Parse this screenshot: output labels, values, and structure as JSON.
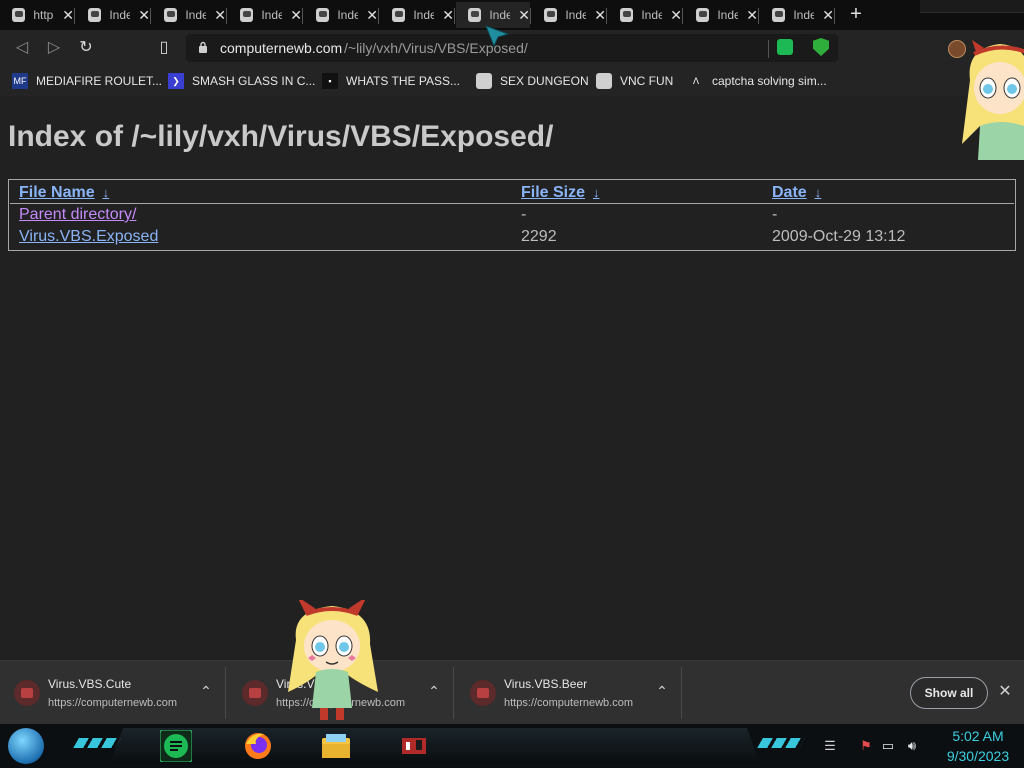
{
  "browser": {
    "tabs": [
      {
        "title": "http",
        "active": false
      },
      {
        "title": "Inde",
        "active": false
      },
      {
        "title": "Inde",
        "active": false
      },
      {
        "title": "Inde",
        "active": false
      },
      {
        "title": "Inde",
        "active": false
      },
      {
        "title": "Inde",
        "active": false
      },
      {
        "title": "Inde",
        "active": true
      },
      {
        "title": "Inde",
        "active": false
      },
      {
        "title": "Inde",
        "active": false
      },
      {
        "title": "Inde",
        "active": false
      },
      {
        "title": "Inde",
        "active": false
      }
    ],
    "close_glyph": "✕",
    "new_tab_glyph": "+",
    "url_host": "computernewb.com",
    "url_path": "/~lily/vxh/Virus/VBS/Exposed/",
    "bookmarks": [
      {
        "icon": "mediafire-icon",
        "badge": "MF",
        "label": "MEDIAFIRE ROULET...",
        "color": "#1f3a8a"
      },
      {
        "icon": "chevron-logo-icon",
        "badge": "❯",
        "label": "SMASH GLASS IN C...",
        "color": "#3b3fd1"
      },
      {
        "icon": "dark-square-icon",
        "badge": "▪",
        "label": "WHATS THE PASS...",
        "color": "#111111"
      },
      {
        "icon": "computer-icon",
        "badge": "",
        "label": "SEX DUNGEON",
        "color": "#cfcfcf"
      },
      {
        "icon": "computer-icon",
        "badge": "",
        "label": "VNC FUN",
        "color": "#cfcfcf"
      },
      {
        "icon": "lambda-icon",
        "badge": "Λ",
        "label": "captcha solving sim...",
        "color": "#242424"
      }
    ]
  },
  "page": {
    "title": "Index of /~lily/vxh/Virus/VBS/Exposed/",
    "columns": {
      "name": "File Name",
      "size": "File Size",
      "date": "Date",
      "sort_glyph": "↓"
    },
    "rows": [
      {
        "name": "Parent directory/",
        "size": "-",
        "date": "-"
      },
      {
        "name": "Virus.VBS.Exposed",
        "size": "2292",
        "date": "2009-Oct-29 13:12"
      }
    ]
  },
  "downloads": {
    "items": [
      {
        "name": "Virus.VBS.Cute",
        "source": "https://computernewb.com"
      },
      {
        "name": "Virus.VBS.",
        "source": "https://computernewb.com"
      },
      {
        "name": "Virus.VBS.Beer",
        "source": "https://computernewb.com"
      }
    ],
    "chevron_glyph": "⌃",
    "show_all": "Show all",
    "close_glyph": "✕"
  },
  "taskbar": {
    "time": "5:02 AM",
    "date": "9/30/2023",
    "accent": "#37c6dc"
  }
}
